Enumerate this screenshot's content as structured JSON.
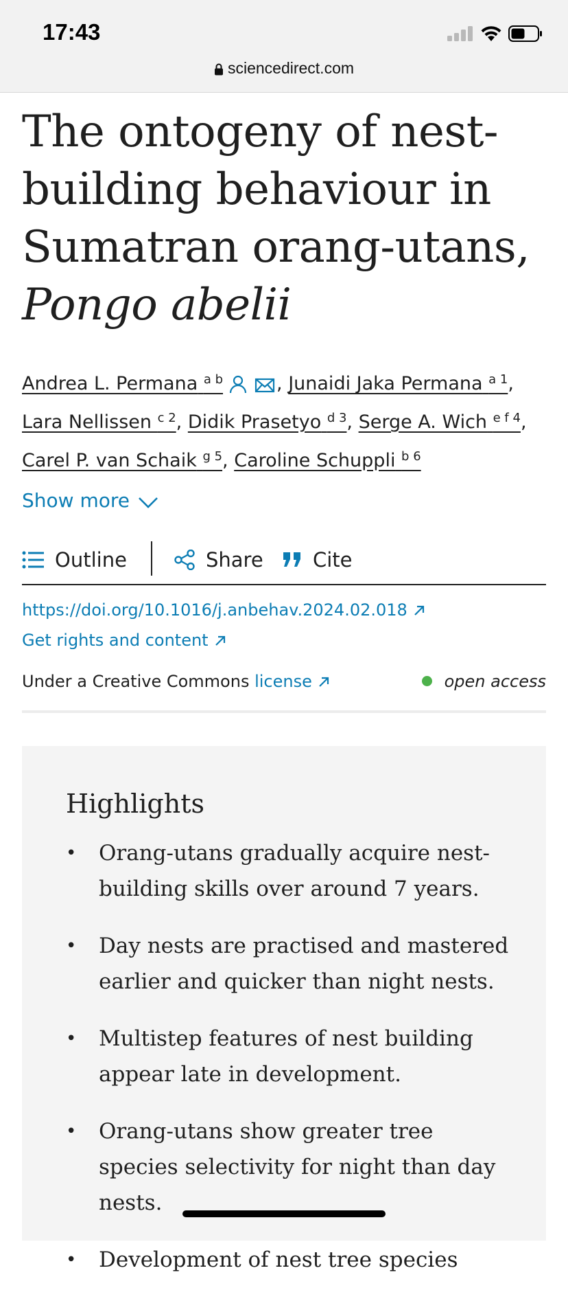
{
  "status_bar": {
    "time": "17:43",
    "url": "sciencedirect.com"
  },
  "article": {
    "title_line1": "The ontogeny of nest-",
    "title_line2": "building behaviour in",
    "title_line3": "Sumatran orang-utans,",
    "title_species": "Pongo abelii"
  },
  "authors": [
    {
      "name": "Andrea L. Permana",
      "sup": "a b"
    },
    {
      "name": "Junaidi Jaka Permana",
      "sup": "a 1"
    },
    {
      "name": "Lara Nellissen",
      "sup": "c 2"
    },
    {
      "name": "Didik Prasetyo",
      "sup": "d 3"
    },
    {
      "name": "Serge A. Wich",
      "sup": "e f 4"
    },
    {
      "name": "Carel P. van Schaik",
      "sup": "g 5"
    },
    {
      "name": "Caroline Schuppli",
      "sup": "b 6"
    }
  ],
  "show_more": "Show more",
  "toolbar": {
    "outline": "Outline",
    "share": "Share",
    "cite": "Cite"
  },
  "links": {
    "doi": "https://doi.org/10.1016/j.anbehav.2024.02.018",
    "rights": "Get rights and content"
  },
  "license": {
    "prefix": "Under a Creative Commons",
    "link": "license",
    "access": "open access"
  },
  "highlights": {
    "title": "Highlights",
    "items": [
      "Orang-utans gradually acquire nest-building skills over around 7 years.",
      "Day nests are practised and mastered earlier and quicker than night nests.",
      "Multistep features of nest building appear late in development.",
      "Orang-utans show greater tree species selectivity for night than day nests.",
      "Development of nest tree species"
    ]
  },
  "colors": {
    "link": "#0c7db4",
    "open_access_dot": "#4db14b",
    "highlights_bg": "#f4f4f4"
  }
}
